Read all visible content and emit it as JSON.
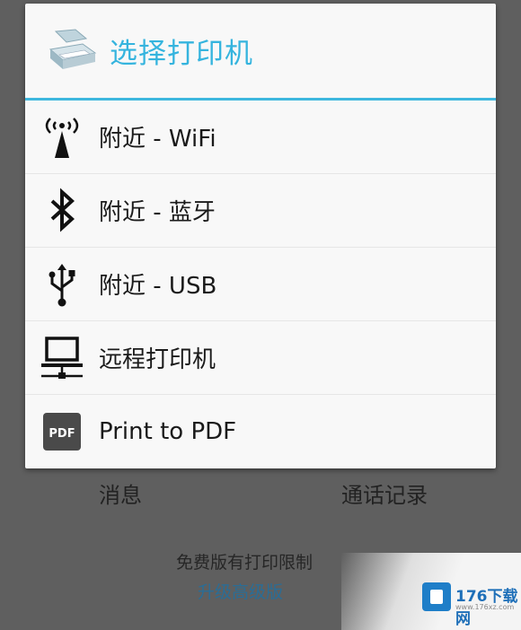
{
  "dialog": {
    "title": "选择打印机",
    "options": [
      {
        "label": "附近 - WiFi",
        "icon": "wifi-tower-icon"
      },
      {
        "label": "附近 - 蓝牙",
        "icon": "bluetooth-icon"
      },
      {
        "label": "附近 - USB",
        "icon": "usb-icon"
      },
      {
        "label": "远程打印机",
        "icon": "remote-computer-icon"
      },
      {
        "label": "Print to PDF",
        "icon": "pdf-icon"
      }
    ]
  },
  "background": {
    "tab_messages": "消息",
    "tab_call_log": "通话记录",
    "free_notice": "免费版有打印限制",
    "upgrade_link": "升级高级版"
  },
  "watermark": {
    "brand": "176下载网",
    "url": "www.176xz.com"
  },
  "colors": {
    "accent": "#35b4de",
    "overlay": "#5f5f5f"
  }
}
